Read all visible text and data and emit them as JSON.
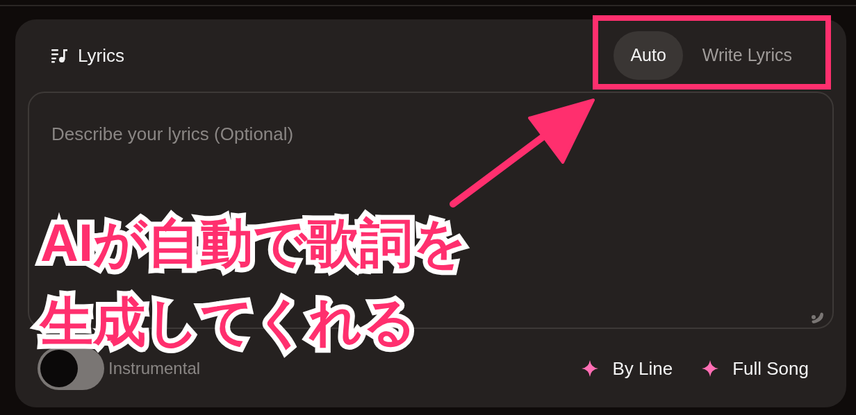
{
  "panel": {
    "title": "Lyrics"
  },
  "tabs": [
    {
      "label": "Auto",
      "selected": true
    },
    {
      "label": "Write Lyrics",
      "selected": false
    }
  ],
  "lyrics_field": {
    "placeholder": "Describe your lyrics (Optional)"
  },
  "instrumental_toggle": {
    "label": "Instrumental",
    "on": false
  },
  "actions": [
    {
      "label": "By Line"
    },
    {
      "label": "Full Song"
    }
  ],
  "annotation": {
    "lines": [
      "AIが自動で歌詞を",
      "生成してくれる"
    ]
  }
}
